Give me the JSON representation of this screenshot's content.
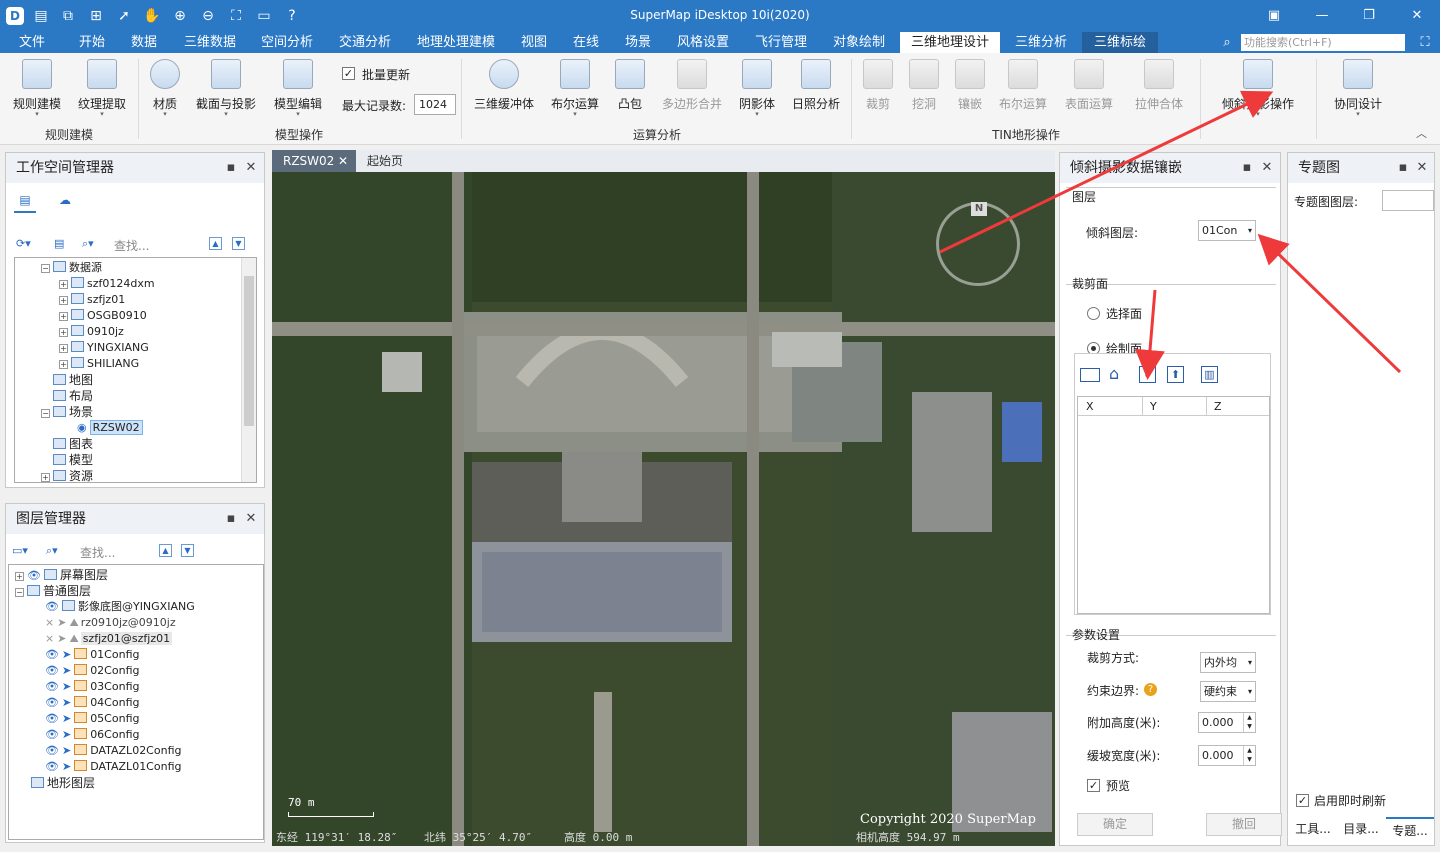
{
  "app": {
    "title": "SuperMap iDesktop 10i(2020)"
  },
  "menu": {
    "items": [
      "文件",
      "开始",
      "数据",
      "三维数据",
      "空间分析",
      "交通分析",
      "地理处理建模",
      "视图",
      "在线",
      "场景",
      "风格设置",
      "飞行管理",
      "对象绘制",
      "三维地理设计",
      "三维分析",
      "三维标绘"
    ],
    "active_index": 13,
    "search_placeholder": "功能搜索(Ctrl+F)"
  },
  "ribbon": {
    "groups": [
      "规则建模",
      "模型操作",
      "运算分析",
      "TIN地形操作"
    ],
    "buttons": {
      "rule_model": "规则建模",
      "texture": "纹理提取",
      "material": "材质",
      "section": "截面与投影",
      "model_edit": "模型编辑",
      "batch_update": "批量更新",
      "max_records_label": "最大记录数:",
      "max_records_value": "1024",
      "buffer3d": "三维缓冲体",
      "boolean": "布尔运算",
      "convex": "凸包",
      "polygon_merge": "多边形合并",
      "shadow": "阴影体",
      "sunlight": "日照分析",
      "clip": "裁剪",
      "dig": "挖洞",
      "inlay": "镶嵌",
      "tin_boolean": "布尔运算",
      "surface_op": "表面运算",
      "extrude": "拉伸合体",
      "oblique_op": "倾斜摄影操作",
      "collab": "协同设计"
    }
  },
  "workspace": {
    "title": "工作空间管理器",
    "search_placeholder": "查找...",
    "tree": {
      "datasources_label": "数据源",
      "datasources": [
        "szf0124dxm",
        "szfjz01",
        "OSGB0910",
        "0910jz",
        "YINGXIANG",
        "SHILIANG"
      ],
      "map": "地图",
      "layout": "布局",
      "scene": "场景",
      "scene_item": "RZSW02",
      "chart": "图表",
      "model": "模型",
      "resource": "资源"
    }
  },
  "layers": {
    "title": "图层管理器",
    "search_placeholder": "查找...",
    "screen": "屏幕图层",
    "normal": "普通图层",
    "items": [
      "影像底图@YINGXIANG",
      "rz0910jz@0910jz",
      "szfjz01@szfjz01",
      "01Config",
      "02Config",
      "03Config",
      "04Config",
      "05Config",
      "06Config",
      "DATAZL02Config",
      "DATAZL01Config"
    ],
    "terrain": "地形图层"
  },
  "mapview": {
    "tabs": [
      "RZSW02",
      "起始页"
    ],
    "scale": "70 m",
    "copyright": "Copyright 2020 SuperMap",
    "status_lon": "东经 119°31′ 18.28″",
    "status_lat": "北纬 35°25′ 4.70″",
    "status_height": "高度 0.00 m",
    "camera_height": "相机高度 594.97 m",
    "compass": "N"
  },
  "oblique": {
    "title": "倾斜摄影数据镶嵌",
    "layer_section": "图层",
    "layer_label": "倾斜图层:",
    "layer_value": "01Con",
    "clip_section": "裁剪面",
    "radio_select": "选择面",
    "radio_draw": "绘制面",
    "col_x": "X",
    "col_y": "Y",
    "col_z": "Z",
    "params_section": "参数设置",
    "clip_mode_label": "裁剪方式:",
    "clip_mode_value": "内外均",
    "boundary_label": "约束边界:",
    "boundary_value": "硬约束",
    "add_height_label": "附加高度(米):",
    "add_height_value": "0.000",
    "slope_label": "缓坡宽度(米):",
    "slope_value": "0.000",
    "preview": "预览",
    "ok": "确定",
    "undo": "撤回"
  },
  "thematic": {
    "title": "专题图",
    "layer_label": "专题图图层:",
    "realtime": "启用即时刷新",
    "tabs": [
      "工具...",
      "目录...",
      "专题..."
    ]
  },
  "colors": {
    "accent": "#2b78c5",
    "arrow": "#ee3a3a"
  }
}
